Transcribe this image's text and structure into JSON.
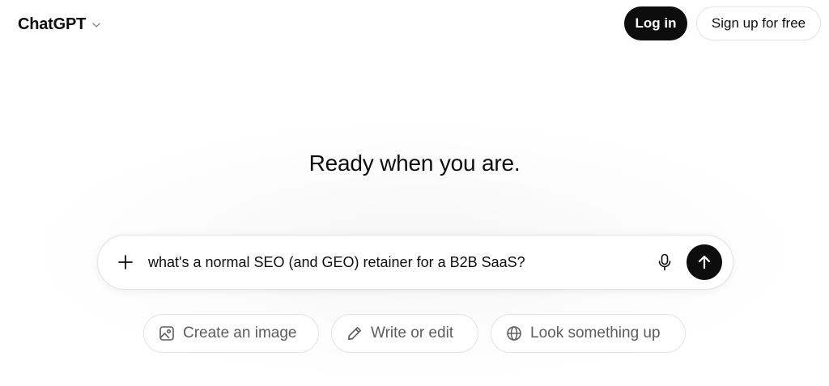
{
  "header": {
    "brand": "ChatGPT",
    "login_label": "Log in",
    "signup_label": "Sign up for free"
  },
  "main": {
    "headline": "Ready when you are."
  },
  "composer": {
    "value": "what's a normal SEO (and GEO) retainer for a B2B SaaS?",
    "icons": {
      "attach": "plus-icon",
      "voice": "microphone-icon",
      "send": "arrow-up-icon"
    }
  },
  "suggestions": [
    {
      "label": "Create an image",
      "icon": "image-icon"
    },
    {
      "label": "Write or edit",
      "icon": "pencil-icon"
    },
    {
      "label": "Look something up",
      "icon": "globe-icon"
    }
  ],
  "colors": {
    "primary_dark": "#0d0d0d",
    "chip_text": "#5d5d5d",
    "border": "#e3e3e3",
    "background": "#ffffff"
  }
}
